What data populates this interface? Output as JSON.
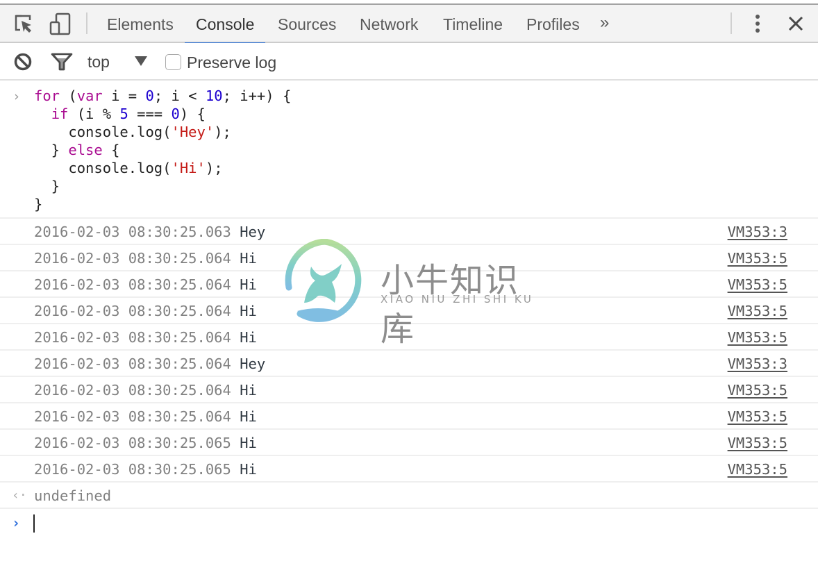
{
  "tabbar": {
    "icons": {
      "inspect": "inspect-element-icon",
      "device": "device-mode-icon",
      "more": "more-vert-icon",
      "close": "close-icon"
    },
    "tabs": [
      {
        "label": "Elements",
        "active": false
      },
      {
        "label": "Console",
        "active": true
      },
      {
        "label": "Sources",
        "active": false
      },
      {
        "label": "Network",
        "active": false
      },
      {
        "label": "Timeline",
        "active": false
      },
      {
        "label": "Profiles",
        "active": false
      }
    ],
    "overflow_label": "»"
  },
  "toolbar": {
    "clear_icon": "clear-console-icon",
    "filter_icon": "filter-icon",
    "context": "top",
    "preserve_log_label": "Preserve log",
    "preserve_log_checked": false
  },
  "console": {
    "input_prompt": "›",
    "input_code": [
      [
        {
          "t": "for",
          "c": "kw"
        },
        {
          "t": " (",
          "c": ""
        },
        {
          "t": "var",
          "c": "kw"
        },
        {
          "t": " i = ",
          "c": ""
        },
        {
          "t": "0",
          "c": "num"
        },
        {
          "t": "; i < ",
          "c": ""
        },
        {
          "t": "10",
          "c": "num"
        },
        {
          "t": "; i++) {",
          "c": ""
        }
      ],
      [
        {
          "t": "  ",
          "c": ""
        },
        {
          "t": "if",
          "c": "kw"
        },
        {
          "t": " (i % ",
          "c": ""
        },
        {
          "t": "5",
          "c": "num"
        },
        {
          "t": " === ",
          "c": ""
        },
        {
          "t": "0",
          "c": "num"
        },
        {
          "t": ") {",
          "c": ""
        }
      ],
      [
        {
          "t": "    console.log(",
          "c": ""
        },
        {
          "t": "'Hey'",
          "c": "str"
        },
        {
          "t": ");",
          "c": ""
        }
      ],
      [
        {
          "t": "  } ",
          "c": ""
        },
        {
          "t": "else",
          "c": "kw"
        },
        {
          "t": " {",
          "c": ""
        }
      ],
      [
        {
          "t": "    console.log(",
          "c": ""
        },
        {
          "t": "'Hi'",
          "c": "str"
        },
        {
          "t": ");",
          "c": ""
        }
      ],
      [
        {
          "t": "  }",
          "c": ""
        }
      ],
      [
        {
          "t": "}",
          "c": ""
        }
      ]
    ],
    "logs": [
      {
        "timestamp": "2016-02-03 08:30:25.063",
        "message": "Hey",
        "source": "VM353:3"
      },
      {
        "timestamp": "2016-02-03 08:30:25.064",
        "message": "Hi",
        "source": "VM353:5"
      },
      {
        "timestamp": "2016-02-03 08:30:25.064",
        "message": "Hi",
        "source": "VM353:5"
      },
      {
        "timestamp": "2016-02-03 08:30:25.064",
        "message": "Hi",
        "source": "VM353:5"
      },
      {
        "timestamp": "2016-02-03 08:30:25.064",
        "message": "Hi",
        "source": "VM353:5"
      },
      {
        "timestamp": "2016-02-03 08:30:25.064",
        "message": "Hey",
        "source": "VM353:3"
      },
      {
        "timestamp": "2016-02-03 08:30:25.064",
        "message": "Hi",
        "source": "VM353:5"
      },
      {
        "timestamp": "2016-02-03 08:30:25.064",
        "message": "Hi",
        "source": "VM353:5"
      },
      {
        "timestamp": "2016-02-03 08:30:25.065",
        "message": "Hi",
        "source": "VM353:5"
      },
      {
        "timestamp": "2016-02-03 08:30:25.065",
        "message": "Hi",
        "source": "VM353:5"
      }
    ],
    "result_arrow": "‹·",
    "result": "undefined",
    "prompt": "›",
    "prompt_value": ""
  },
  "watermark": {
    "title": "小牛知识库",
    "subtitle": "XIAO NIU ZHI SHI KU"
  },
  "colors": {
    "accent": "#3879d9",
    "keyword": "#aa0d91",
    "number": "#1c00cf",
    "string": "#c41a16"
  }
}
